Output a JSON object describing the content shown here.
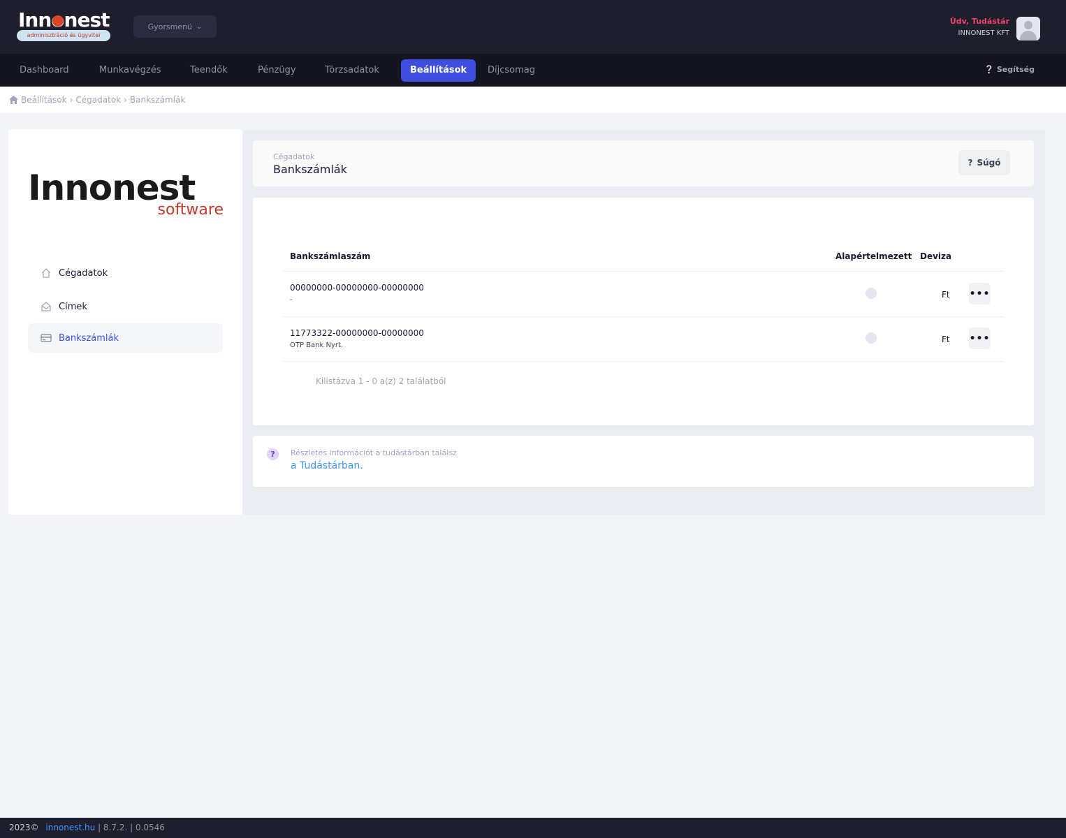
{
  "header": {
    "logo_text": "Innonest",
    "logo_subtitle": "adminisztráció és ügyvitel",
    "quick_menu_label": "Gyorsmenü",
    "greeting": "Üdv, Tudástár",
    "company": "INNONEST KFT"
  },
  "nav": {
    "items": [
      "Dashboard",
      "Munkavégzés",
      "Teendők",
      "Pénzügy",
      "Törzsadatok",
      "Beállítások",
      "Díjcsomag"
    ],
    "active": "Beállítások",
    "help_label": "Segítség"
  },
  "breadcrumb": [
    "Beállítások",
    "Cégadatok",
    "Bankszámlák"
  ],
  "sidebar": {
    "logo_name": "Innonest",
    "logo_software": "software",
    "items": [
      {
        "label": "Cégadatok",
        "icon": "home-icon"
      },
      {
        "label": "Címek",
        "icon": "mail-icon"
      },
      {
        "label": "Bankszámlák",
        "icon": "credit-card-icon"
      }
    ],
    "active": "Bankszámlák"
  },
  "page": {
    "subtitle": "Cégadatok",
    "title": "Bankszámlák",
    "help_button": "Súgó"
  },
  "table": {
    "columns": [
      "Bankszámlaszám",
      "Alapértelmezett",
      "Deviza"
    ],
    "rows": [
      {
        "account": "00000000-00000000-00000000",
        "bank": "-",
        "default": false,
        "currency": "Ft"
      },
      {
        "account": "11773322-00000000-00000000",
        "bank": "OTP Bank Nyrt.",
        "default": false,
        "currency": "Ft"
      }
    ],
    "list_info": "Kilistázva 1 - 0 a(z) 2 találatból"
  },
  "info": {
    "text": "Részletes információt a tudástárban találsz",
    "link": "a Tudástárban."
  },
  "footer": {
    "year": "2023©",
    "link": "innonest.hu",
    "version": "| 8.7.2. | 0.0546"
  },
  "colors": {
    "header_bg": "#1e1e2d",
    "nav_bg": "#151521",
    "accent": "#3f4de0",
    "greeting": "#f1416c",
    "link": "#3e97ff"
  }
}
